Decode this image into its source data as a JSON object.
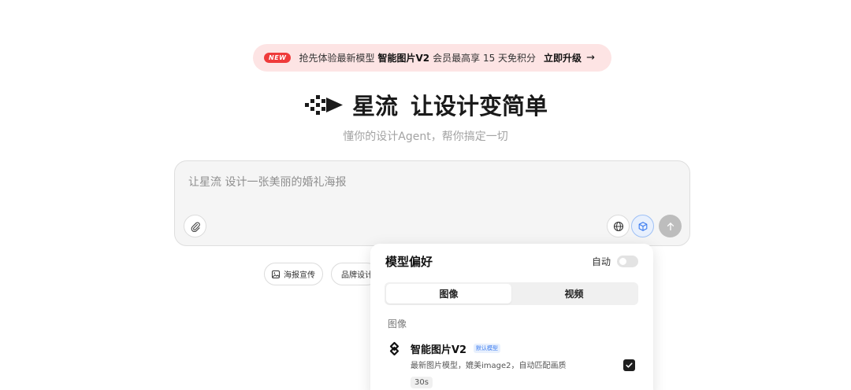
{
  "promo": {
    "badge": "NEW",
    "text_before": "抢先体验最新模型",
    "model": "智能图片V2",
    "text_after": "会员最高享 15 天免积分",
    "cta": "立即升级",
    "arrow": "→"
  },
  "hero": {
    "brand": "星流",
    "slogan": "让设计变简单",
    "subtitle": "懂你的设计Agent，帮你搞定一切"
  },
  "composer": {
    "placeholder": "让星流 设计一张美丽的婚礼海报",
    "buttons": [
      "attach-icon",
      "globe-icon",
      "cube-icon",
      "send-icon"
    ]
  },
  "chips": [
    {
      "label": "海报宣传",
      "icon": "image-icon"
    },
    {
      "label": "品牌设计",
      "icon": "star-icon"
    }
  ],
  "model_popover": {
    "title": "模型偏好",
    "auto_label": "自动",
    "auto_enabled": false,
    "tabs": [
      {
        "label": "图像",
        "active": true
      },
      {
        "label": "视频",
        "active": false
      }
    ],
    "section_label": "图像",
    "models": [
      {
        "name": "智能图片V2",
        "tag": "默认模型",
        "description": "最新图片模型，媲美image2，自动匹配画质",
        "time": "30s",
        "selected": true
      }
    ]
  },
  "colors": {
    "promo_bg": "#fde4e4",
    "badge_red": "#ef3b3b",
    "accent_blue": "#3a7bf0"
  }
}
